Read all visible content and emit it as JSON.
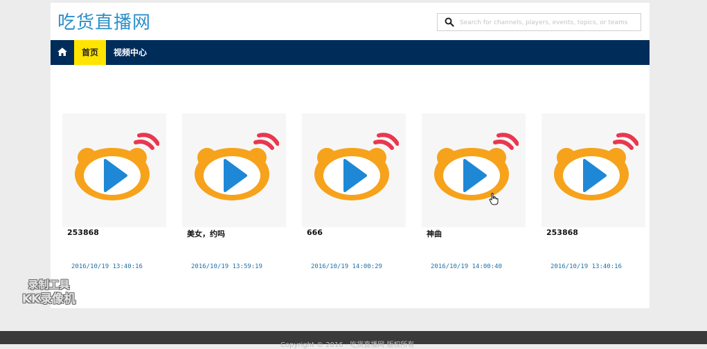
{
  "header": {
    "site_title": "吃货直播网",
    "search_placeholder": "Search for channels, players, events, topics, or teams"
  },
  "nav": {
    "home_icon": "home-icon",
    "items": [
      {
        "label": "首页",
        "active": true
      },
      {
        "label": "视频中心",
        "active": false
      }
    ]
  },
  "videos": [
    {
      "title": "253868",
      "time": "2016/10/19 13:40:16"
    },
    {
      "title": "美女，约吗",
      "time": "2016/10/19 13:59:19"
    },
    {
      "title": "666",
      "time": "2016/10/19 14:00:29"
    },
    {
      "title": "神曲",
      "time": "2016/10/19 14:00:40"
    },
    {
      "title": "253868",
      "time": "2016/10/19 13:40:16"
    }
  ],
  "footer": {
    "copyright": "Copyright © 2016 · 吃货直播网 版权所有"
  },
  "watermark": {
    "line1": "录制工具",
    "line2": "KK录像机"
  },
  "colors": {
    "nav_bg": "#002c5a",
    "nav_active": "#ffe400",
    "title_blue": "#2a8fc9",
    "logo_orange": "#f7a21b",
    "play_blue": "#1e88d6",
    "signal_red": "#e8384f"
  }
}
